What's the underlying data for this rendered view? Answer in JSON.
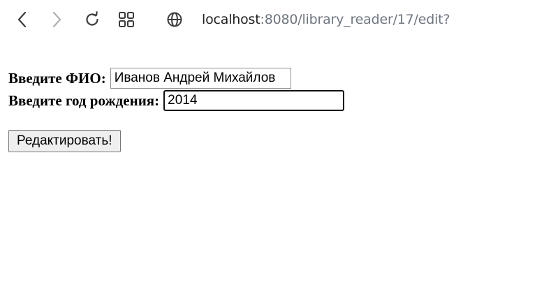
{
  "browser": {
    "icons": {
      "back": "chevron-left-icon",
      "forward": "chevron-right-icon",
      "reload": "reload-icon",
      "apps": "grid-icon",
      "site_info": "globe-icon"
    },
    "url_host": "localhost",
    "url_rest": ":8080/library_reader/17/edit?"
  },
  "form": {
    "name_label": "Введите ФИО:",
    "name_value": "Иванов Андрей Михайлов",
    "year_label": "Введите год рождения:",
    "year_value": "2014",
    "submit_label": "Редактировать!"
  },
  "colors": {
    "icon": "#3c3c3c",
    "icon_disabled": "#b0b0b0",
    "url_muted": "#6e7681"
  }
}
